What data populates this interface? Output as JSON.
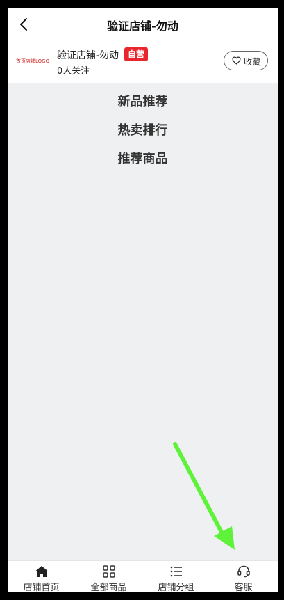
{
  "header": {
    "title": "验证店铺-勿动"
  },
  "store": {
    "logo_text": "首页店铺LOGO",
    "name": "验证店铺-勿动",
    "badge": "自营",
    "followers": "0人关注",
    "favorite_label": "收藏"
  },
  "sections": [
    "新品推荐",
    "热卖排行",
    "推荐商品"
  ],
  "tabbar": {
    "items": [
      {
        "label": "店铺首页",
        "icon": "home-icon",
        "active": true
      },
      {
        "label": "全部商品",
        "icon": "grid-icon",
        "active": false
      },
      {
        "label": "店铺分组",
        "icon": "list-icon",
        "active": false
      },
      {
        "label": "客服",
        "icon": "headset-icon",
        "active": false
      }
    ]
  },
  "colors": {
    "badge": "#e9262e",
    "logo": "#d62828",
    "page_bg": "#eff0f2",
    "annotation_arrow": "#5ef23a"
  }
}
